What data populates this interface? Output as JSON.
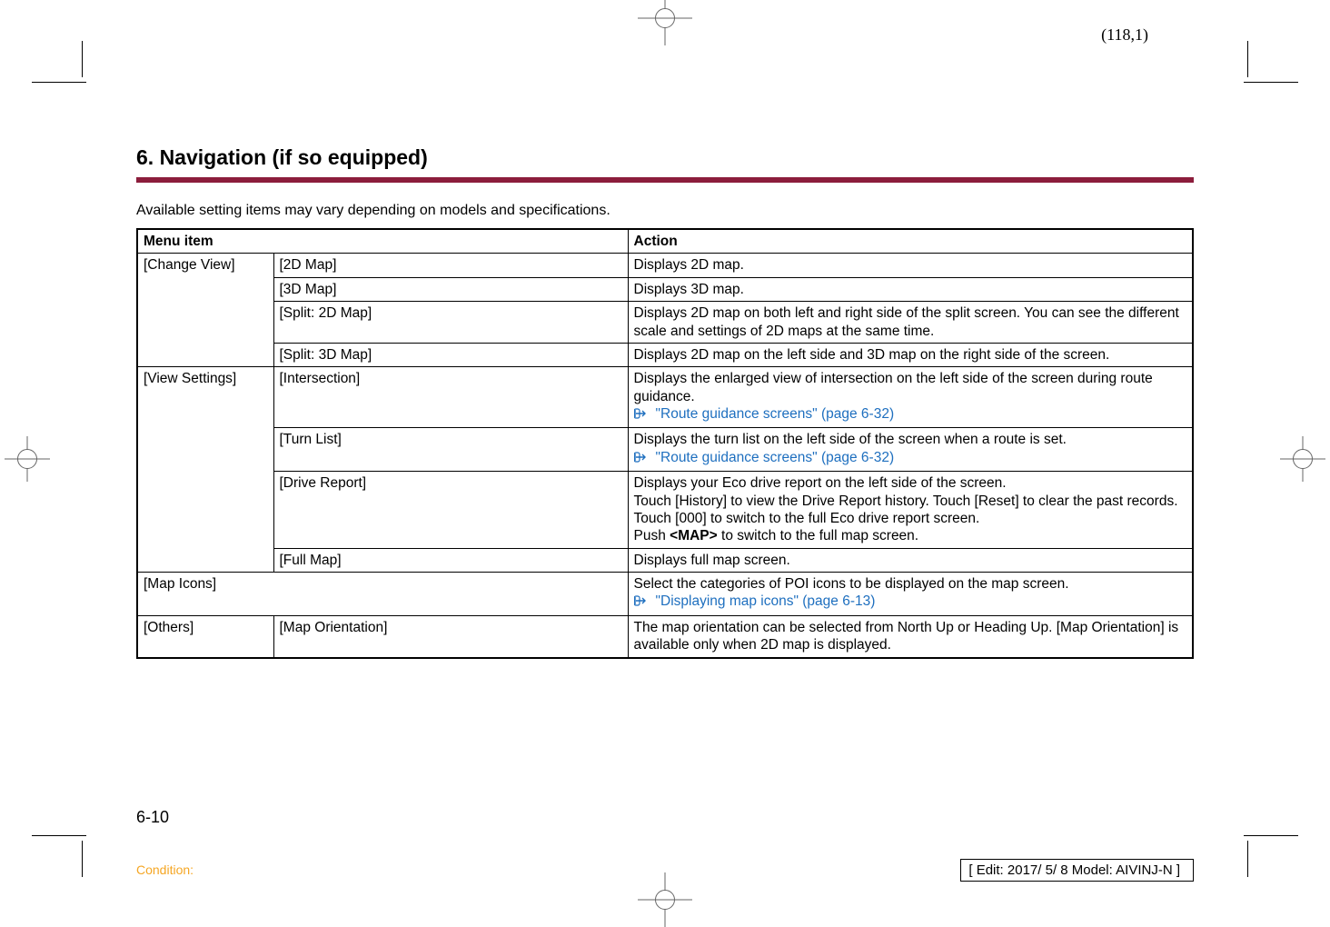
{
  "top_page_ref": "(118,1)",
  "section_title": "6. Navigation (if so equipped)",
  "intro": "Available setting items may vary depending on models and specifications.",
  "headers": {
    "menu_item": "Menu item",
    "action": "Action"
  },
  "rows": {
    "change_view": {
      "label": "[Change View]",
      "r2d": {
        "label": "[2D Map]",
        "action": "Displays 2D map."
      },
      "r3d": {
        "label": "[3D Map]",
        "action": "Displays 3D map."
      },
      "split2d": {
        "label": "[Split: 2D Map]",
        "action": "Displays 2D map on both left and right side of the split screen. You can see the different scale and settings of 2D maps at the same time."
      },
      "split3d": {
        "label": "[Split: 3D Map]",
        "action": "Displays 2D map on the left side and 3D map on the right side of the screen."
      }
    },
    "view_settings": {
      "label": "[View Settings]",
      "intersection": {
        "label": "[Intersection]",
        "action": "Displays the enlarged view of intersection on the left side of the screen during route guidance.",
        "ref": "\"Route guidance screens\" (page 6-32)"
      },
      "turn_list": {
        "label": "[Turn List]",
        "action": "Displays the turn list on the left side of the screen when a route is set.",
        "ref": "\"Route guidance screens\" (page 6-32)"
      },
      "drive_report": {
        "label": "[Drive Report]",
        "action_l1": "Displays your Eco drive report on the left side of the screen.",
        "action_l2": "Touch [History] to view the Drive Report history. Touch [Reset] to clear the past records.",
        "action_l3": "Touch [000] to switch to the full Eco drive report screen.",
        "action_l4a": "Push ",
        "action_l4b": "<MAP>",
        "action_l4c": " to switch to the full map screen."
      },
      "full_map": {
        "label": "[Full Map]",
        "action": "Displays full map screen."
      }
    },
    "map_icons": {
      "label": "[Map Icons]",
      "action": "Select the categories of POI icons to be displayed on the map screen.",
      "ref": "\"Displaying map icons\" (page 6-13)"
    },
    "others": {
      "label": "[Others]",
      "map_orientation": {
        "label": "[Map Orientation]",
        "action": "The map orientation can be selected from North Up or Heading Up. [Map Orientation] is available only when 2D map is displayed."
      }
    }
  },
  "page_number": "6-10",
  "condition_label": "Condition:",
  "edit_box": "[ Edit: 2017/ 5/ 8   Model: AIVINJ-N ]"
}
